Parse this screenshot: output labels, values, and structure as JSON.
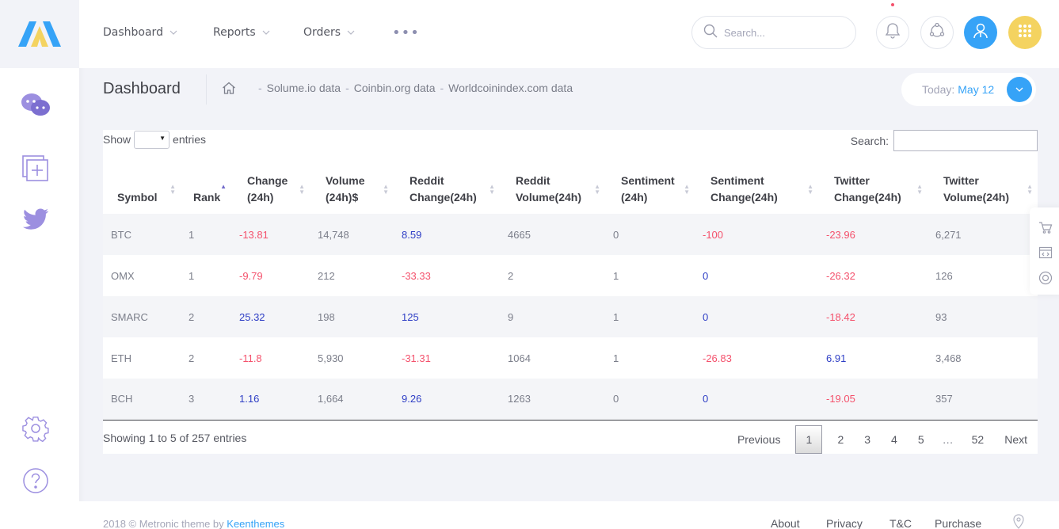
{
  "header": {
    "nav": [
      {
        "label": "Dashboard"
      },
      {
        "label": "Reports"
      },
      {
        "label": "Orders"
      }
    ],
    "more_label": "•••",
    "search_placeholder": "Search..."
  },
  "subheader": {
    "title": "Dashboard",
    "breadcrumbs": [
      "Solume.io data",
      "Coinbin.org data",
      "Worldcoinindex.com data"
    ],
    "date_label": "Today:",
    "date_value": "May 12"
  },
  "table": {
    "show_label": "Show",
    "entries_label": "entries",
    "search_label": "Search:",
    "columns": [
      {
        "line1": "",
        "line2": "Symbol"
      },
      {
        "line1": "",
        "line2": "Rank"
      },
      {
        "line1": "Change",
        "line2": "(24h)"
      },
      {
        "line1": "Volume",
        "line2": "(24h)$"
      },
      {
        "line1": "Reddit",
        "line2": "Change(24h)"
      },
      {
        "line1": "Reddit",
        "line2": "Volume(24h)"
      },
      {
        "line1": "Sentiment",
        "line2": "(24h)"
      },
      {
        "line1": "Sentiment",
        "line2": "Change(24h)"
      },
      {
        "line1": "Twitter",
        "line2": "Change(24h)"
      },
      {
        "line1": "Twitter",
        "line2": "Volume(24h)"
      }
    ],
    "rows": [
      [
        "BTC",
        "1",
        "-13.81",
        "14,748",
        "8.59",
        "4665",
        "0",
        "-100",
        "-23.96",
        "6,271"
      ],
      [
        "OMX",
        "1",
        "-9.79",
        "212",
        "-33.33",
        "2",
        "1",
        "0",
        "-26.32",
        "126"
      ],
      [
        "SMARC",
        "2",
        "25.32",
        "198",
        "125",
        "9",
        "1",
        "0",
        "-18.42",
        "93"
      ],
      [
        "ETH",
        "2",
        "-11.8",
        "5,930",
        "-31.31",
        "1064",
        "1",
        "-26.83",
        "6.91",
        "3,468"
      ],
      [
        "BCH",
        "3",
        "1.16",
        "1,664",
        "9.26",
        "1263",
        "0",
        "0",
        "-19.05",
        "357"
      ]
    ],
    "info": "Showing 1 to 5 of 257 entries",
    "pager": {
      "previous": "Previous",
      "pages": [
        "1",
        "2",
        "3",
        "4",
        "5"
      ],
      "ellipsis": "…",
      "last": "52",
      "next": "Next"
    }
  },
  "footer": {
    "copyright": "2018 © Metronic theme by",
    "author": "Keenthemes",
    "links": [
      "About",
      "Privacy",
      "T&C",
      "Purchase"
    ]
  },
  "colors": {
    "accent": "#36a3f7",
    "warning": "#f4d360",
    "negative": "#f4516c",
    "positive": "#2e3ec5",
    "sidebar_icon": "#9c8fe0"
  }
}
